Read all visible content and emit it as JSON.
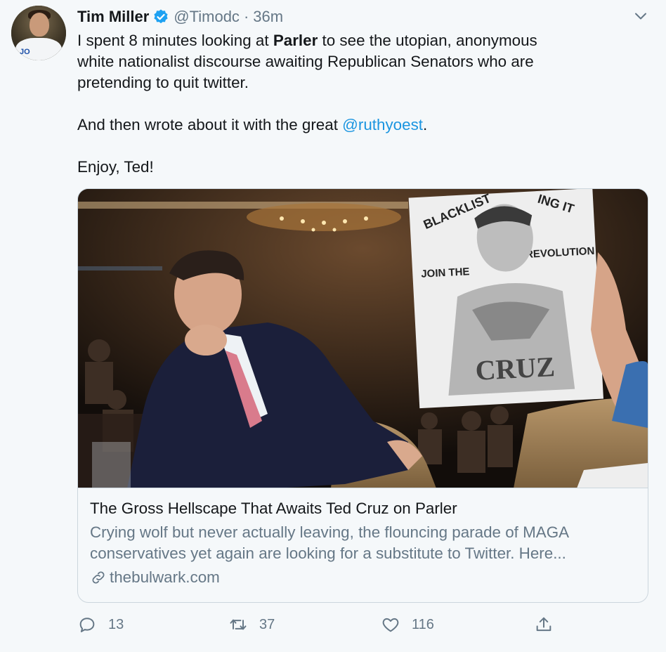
{
  "tweet": {
    "author": {
      "name": "Tim Miller",
      "handle": "@Timodc",
      "verified": true,
      "avatar_shirt_text": "JO"
    },
    "separator": "·",
    "time": "36m",
    "text": {
      "line1_before": "I spent 8 minutes looking at ",
      "line1_bold": "Parler",
      "line1_after": " to see the utopian, anonymous",
      "line2": "white nationalist discourse awaiting Republican Senators who are",
      "line3": "pretending to quit twitter.",
      "line4_before": "And then wrote about it with the great ",
      "line4_mention": "@ruthyoest",
      "line4_after": ".",
      "line5": "Enjoy, Ted!"
    },
    "card": {
      "image_sign": {
        "top": "BLACKLIST",
        "top_right": "ING IT",
        "left": "JOIN THE",
        "right": "REVOLUTION",
        "bottom": "CRUZ"
      },
      "title": "The Gross Hellscape That Awaits Ted Cruz on Parler",
      "description_line1": "Crying wolf but never actually leaving, the flouncing parade of MAGA",
      "description_line2": "conservatives yet again are looking for a substitute to Twitter. Here...",
      "domain": "thebulwark.com"
    },
    "actions": {
      "reply_count": "13",
      "retweet_count": "37",
      "like_count": "116"
    }
  },
  "colors": {
    "background": "#f5f8fa",
    "text": "#14171a",
    "secondary": "#657786",
    "link": "#1b95e0",
    "verified": "#1da1f2",
    "border": "#ccd6dd"
  },
  "icons": [
    "verified-badge-icon",
    "chevron-down-icon",
    "link-icon",
    "reply-icon",
    "retweet-icon",
    "like-icon",
    "share-icon"
  ]
}
